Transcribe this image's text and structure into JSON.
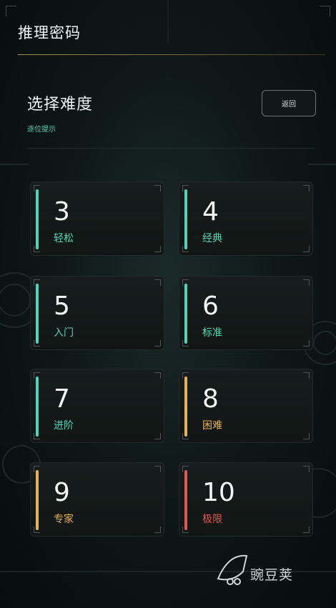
{
  "header": {
    "title": "推理密码"
  },
  "section": {
    "title": "选择难度",
    "hint": "逐位提示",
    "back_label": "返回"
  },
  "difficulties": [
    {
      "number": "3",
      "label": "轻松",
      "color": "#4fd6b8"
    },
    {
      "number": "4",
      "label": "经典",
      "color": "#4fd6b8"
    },
    {
      "number": "5",
      "label": "入门",
      "color": "#4fd6b8"
    },
    {
      "number": "6",
      "label": "标准",
      "color": "#4fd6b8"
    },
    {
      "number": "7",
      "label": "进阶",
      "color": "#4fd6b8"
    },
    {
      "number": "8",
      "label": "困难",
      "color": "#e8b24f"
    },
    {
      "number": "9",
      "label": "专家",
      "color": "#e8b24f"
    },
    {
      "number": "10",
      "label": "极限",
      "color": "#e2584a"
    }
  ],
  "watermark": {
    "text": "豌豆荚"
  }
}
